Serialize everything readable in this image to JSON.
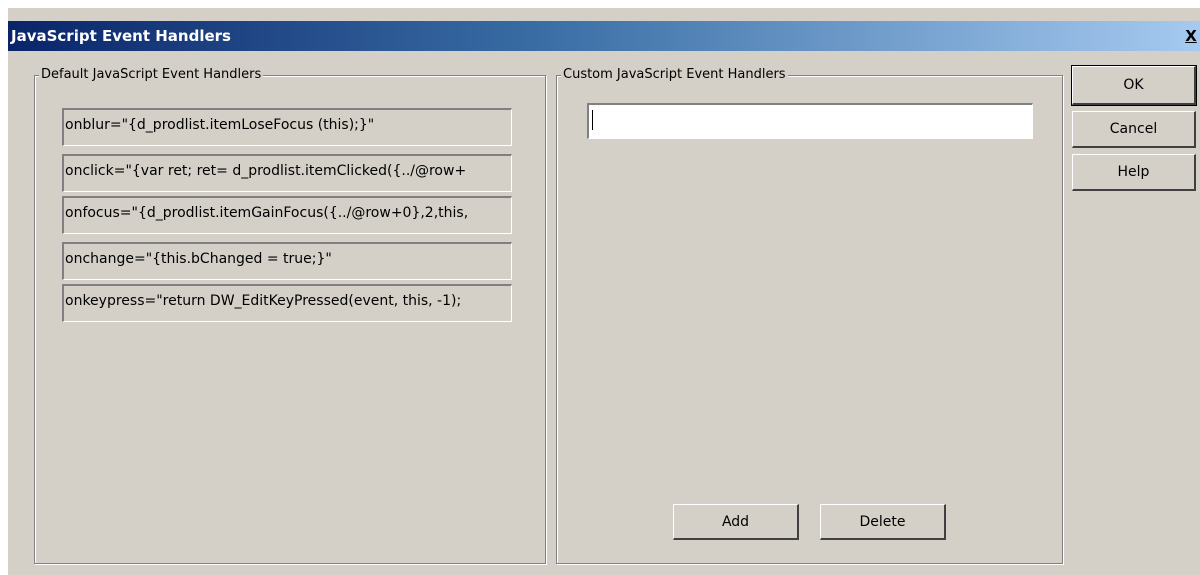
{
  "window": {
    "title": "JavaScript Event Handlers",
    "close_label": "X"
  },
  "default_group": {
    "label": "Default JavaScript Event Handlers",
    "handlers": [
      "onblur=\"{d_prodlist.itemLoseFocus (this);}\"",
      "onclick=\"{var ret;  ret= d_prodlist.itemClicked({../@row+",
      "onfocus=\"{d_prodlist.itemGainFocus({../@row+0},2,this,",
      "onchange=\"{this.bChanged = true;}\"",
      "onkeypress=\"return DW_EditKeyPressed(event, this, -1);"
    ]
  },
  "custom_group": {
    "label": "Custom JavaScript Event Handlers",
    "input_value": "",
    "add_label": "Add",
    "delete_label": "Delete"
  },
  "buttons": {
    "ok_label": "OK",
    "cancel_label": "Cancel",
    "help_label": "Help"
  },
  "colors": {
    "dialog_background": "#d4d0c8",
    "titlebar_start": "#0a246a",
    "titlebar_end": "#a6caf0"
  }
}
